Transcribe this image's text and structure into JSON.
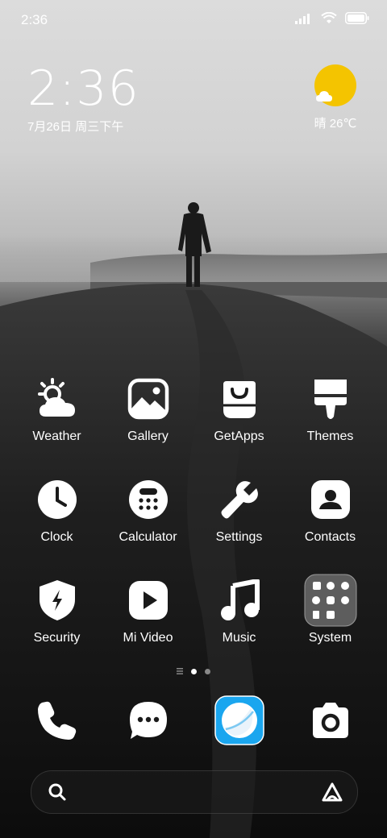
{
  "status_bar": {
    "time": "2:36"
  },
  "clock_widget": {
    "time": "2:36",
    "date": "7月26日 周三下午"
  },
  "weather_widget": {
    "temp": "晴 26℃"
  },
  "apps": [
    {
      "label": "Weather",
      "icon": "weather-icon"
    },
    {
      "label": "Gallery",
      "icon": "gallery-icon"
    },
    {
      "label": "GetApps",
      "icon": "getapps-icon"
    },
    {
      "label": "Themes",
      "icon": "themes-icon"
    },
    {
      "label": "Clock",
      "icon": "clock-icon"
    },
    {
      "label": "Calculator",
      "icon": "calculator-icon"
    },
    {
      "label": "Settings",
      "icon": "wrench-icon"
    },
    {
      "label": "Contacts",
      "icon": "contacts-icon"
    },
    {
      "label": "Security",
      "icon": "shield-icon"
    },
    {
      "label": "Mi Video",
      "icon": "play-icon"
    },
    {
      "label": "Music",
      "icon": "music-note-icon"
    },
    {
      "label": "System",
      "icon": "system-folder-icon"
    }
  ],
  "dock": [
    {
      "icon": "phone-icon"
    },
    {
      "icon": "messages-icon"
    },
    {
      "icon": "browser-icon"
    },
    {
      "icon": "camera-icon"
    }
  ],
  "colors": {
    "weather_sun": "#f4c400",
    "browser_blue": "#1aa6ef"
  }
}
